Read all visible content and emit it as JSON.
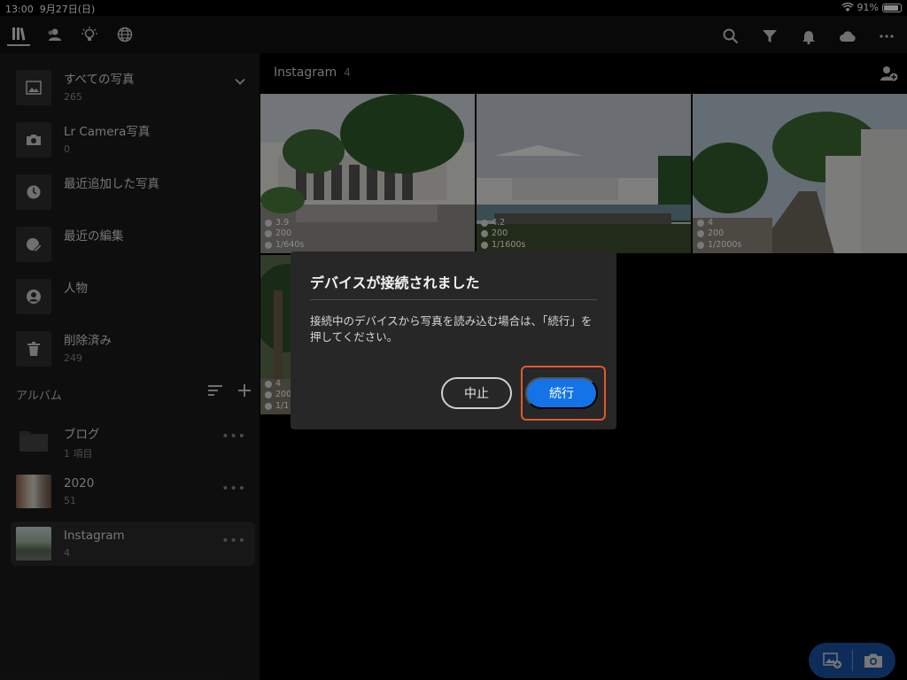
{
  "status_bar": {
    "time": "13:00",
    "date": "9月27日(日)",
    "battery": "91%",
    "battery_level": 0.91
  },
  "toolbar": {
    "left_icons": [
      "library-icon",
      "people-icon",
      "learn-icon",
      "discover-icon"
    ],
    "right_icons": [
      "search-icon",
      "filter-icon",
      "bell-icon",
      "cloud-icon",
      "more-icon"
    ]
  },
  "sidebar": {
    "items": [
      {
        "label": "すべての写真",
        "count": "265",
        "icon": "all-photos-icon"
      },
      {
        "label": "Lr Camera写真",
        "count": "0",
        "icon": "camera-icon"
      },
      {
        "label": "最近追加した写真",
        "count": "",
        "icon": "clock-icon"
      },
      {
        "label": "最近の編集",
        "count": "",
        "icon": "edit-icon"
      },
      {
        "label": "人物",
        "count": "",
        "icon": "person-icon"
      },
      {
        "label": "削除済み",
        "count": "249",
        "icon": "trash-icon"
      }
    ],
    "albums_header": "アルバム",
    "albums": [
      {
        "name": "ブログ",
        "count": "1 項目"
      },
      {
        "name": "2020",
        "count": "51"
      },
      {
        "name": "Instagram",
        "count": "4"
      }
    ]
  },
  "main": {
    "title": "Instagram",
    "count": "4",
    "photos": [
      {
        "aperture": "3.9",
        "iso": "200",
        "shutter": "1/640s"
      },
      {
        "aperture": "4.2",
        "iso": "200",
        "shutter": "1/1600s"
      },
      {
        "aperture": "4",
        "iso": "200",
        "shutter": "1/2000s"
      },
      {
        "aperture": "4",
        "iso": "200",
        "shutter": "1/1"
      }
    ]
  },
  "dialog": {
    "title": "デバイスが接続されました",
    "body": "接続中のデバイスから写真を読み込む場合は、「続行」を押してください。",
    "cancel_label": "中止",
    "continue_label": "続行",
    "highlight_color": "#e2592b",
    "accent_color": "#1473e6"
  }
}
